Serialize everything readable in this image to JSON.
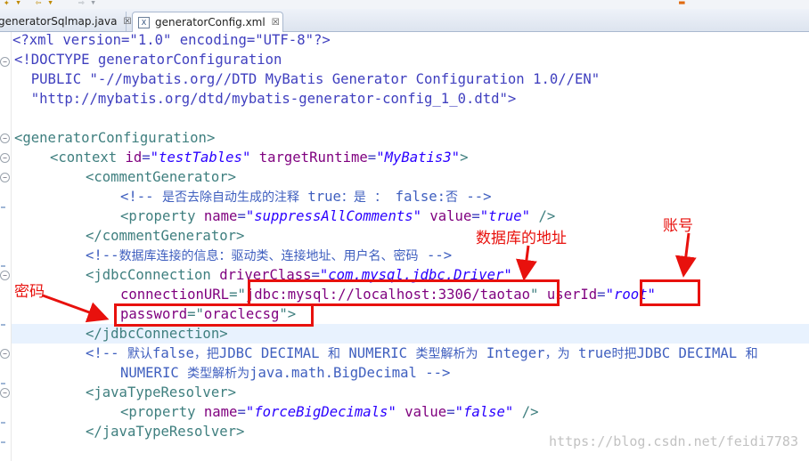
{
  "tabs": [
    {
      "label": "generatorSqlmap.java",
      "active": false
    },
    {
      "label": "generatorConfig.xml",
      "active": true
    }
  ],
  "tab_close_glyph": "☒",
  "editor": {
    "lines": [
      "<?xml version=\"1.0\" encoding=\"UTF-8\"?>",
      "<!DOCTYPE generatorConfiguration",
      "  PUBLIC \"-//mybatis.org//DTD MyBatis Generator Configuration 1.0//EN\"",
      "  \"http://mybatis.org/dtd/mybatis-generator-config_1_0.dtd\">",
      "<generatorConfiguration>",
      "<context id=\"testTables\" targetRuntime=\"MyBatis3\">",
      "<commentGenerator>",
      "<!-- 是否去除自动生成的注释 true：是 ： false:否 -->",
      "<property name=\"suppressAllComments\" value=\"true\" />",
      "</commentGenerator>",
      "<!--数据库连接的信息：驱动类、连接地址、用户名、密码 -->",
      "<jdbcConnection driverClass=\"com.mysql.jdbc.Driver\"",
      "connectionURL=\"jdbc:mysql://localhost:3306/taotao\" userId=\"root\"",
      "password=\"oraclecsg\">",
      "</jdbcConnection>",
      "<!-- 默认false，把JDBC DECIMAL 和 NUMERIC 类型解析为 Integer，为 true时把JDBC DECIMAL 和",
      "NUMERIC 类型解析为java.math.BigDecimal -->",
      "<javaTypeResolver>",
      "<property name=\"forceBigDecimals\" value=\"false\" />",
      "</javaTypeResolver>"
    ]
  },
  "annotations": {
    "db_address": "数据库的地址",
    "account": "账号",
    "password": "密码",
    "color": "#e8110d"
  },
  "watermark": "https://blog.csdn.net/feidi7783"
}
